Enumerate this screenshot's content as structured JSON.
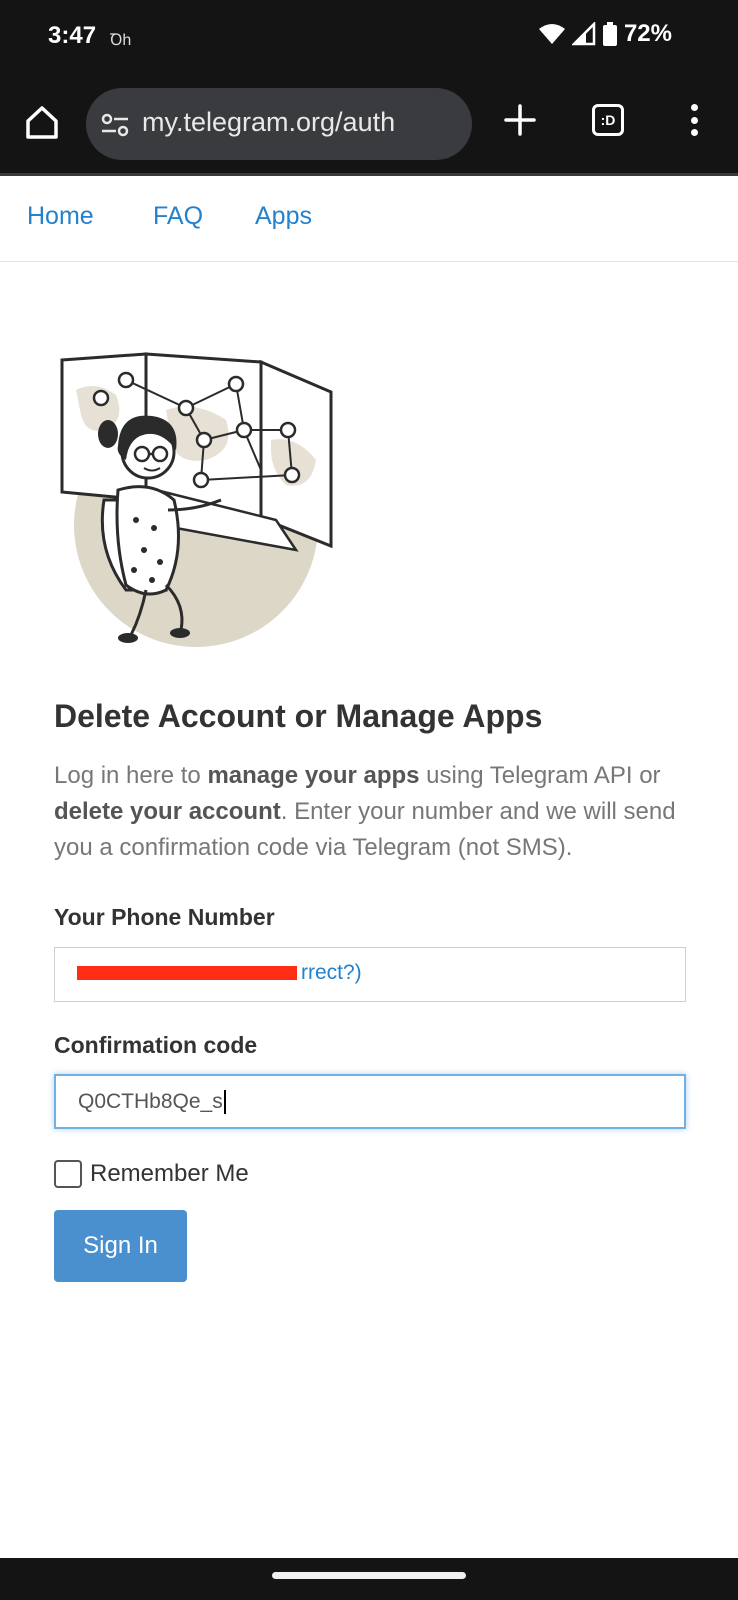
{
  "status_bar": {
    "time": "3:47",
    "extra_icon": "Ꝺh",
    "battery_pct": "72%"
  },
  "browser": {
    "url": "my.telegram.org/auth",
    "tabs_label": ":D",
    "icons": {
      "home": "home-icon",
      "site_info": "tune-icon",
      "new_tab": "plus-icon",
      "tabs": "tab-switcher-icon",
      "menu": "more-vert-icon"
    }
  },
  "nav": {
    "home": "Home",
    "faq": "FAQ",
    "apps": "Apps"
  },
  "content": {
    "title": "Delete Account or Manage Apps",
    "intro_part1": "Log in here to ",
    "intro_bold1": "manage your apps",
    "intro_part2": " using Telegram API or ",
    "intro_bold2": "delete your account",
    "intro_part3": ". Enter your number and we will send you a confirmation code via Telegram (not SMS)."
  },
  "form": {
    "phone_label": "Your Phone Number",
    "phone_value": "",
    "phone_link": "rrect?)",
    "code_label": "Confirmation code",
    "code_value": "Q0CTHb8Qe_s",
    "remember_label": "Remember Me",
    "remember_checked": false,
    "signin_label": "Sign In"
  },
  "colors": {
    "link": "#2481cc",
    "button": "#4a90cf",
    "status_bg": "#141414",
    "redaction": "#ff2d16"
  }
}
